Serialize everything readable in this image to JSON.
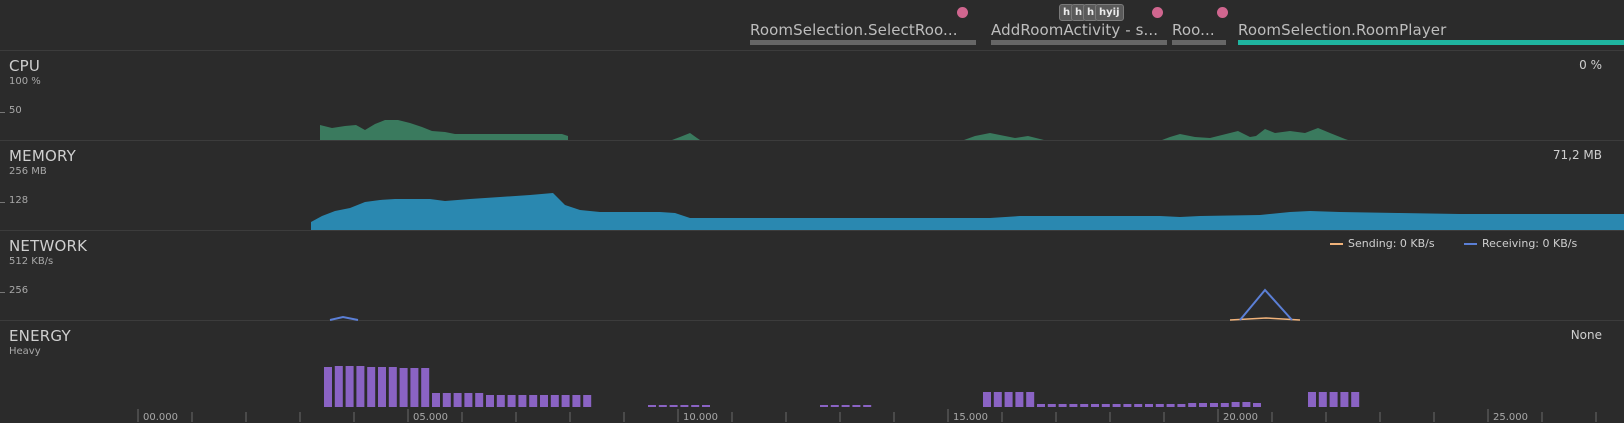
{
  "activities": [
    {
      "label": "RoomSelection.SelectRoo...",
      "active": false
    },
    {
      "label": "AddRoomActivity - s...",
      "active": false
    },
    {
      "label": "Roo...",
      "active": false
    },
    {
      "label": "RoomSelection.RoomPlayer",
      "active": true
    }
  ],
  "event_tags": [
    "h",
    "h",
    "h",
    "hyij"
  ],
  "lanes": {
    "cpu": {
      "title": "CPU",
      "unit": "100 %",
      "tick": "50",
      "value": "0 %"
    },
    "memory": {
      "title": "MEMORY",
      "unit": "256 MB",
      "tick": "128",
      "value": "71,2 MB"
    },
    "network": {
      "title": "NETWORK",
      "unit": "512 KB/s",
      "tick": "256",
      "legend_sending": "Sending: 0 KB/s",
      "legend_receiving": "Receiving: 0 KB/s"
    },
    "energy": {
      "title": "ENERGY",
      "unit": "Heavy",
      "value": "None"
    }
  },
  "time_axis": {
    "labels": [
      "00.000",
      "05.000",
      "10.000",
      "15.000",
      "20.000",
      "25.000"
    ]
  },
  "colors": {
    "background": "#2b2b2b",
    "cpu": "#3a7a5e",
    "memory": "#2a88b0",
    "network_sending": "#f0b27a",
    "network_receiving": "#5b7fd6",
    "energy": "#8a63c4",
    "activity_active": "#1fb5a0",
    "event_dot": "#d0668f"
  }
}
